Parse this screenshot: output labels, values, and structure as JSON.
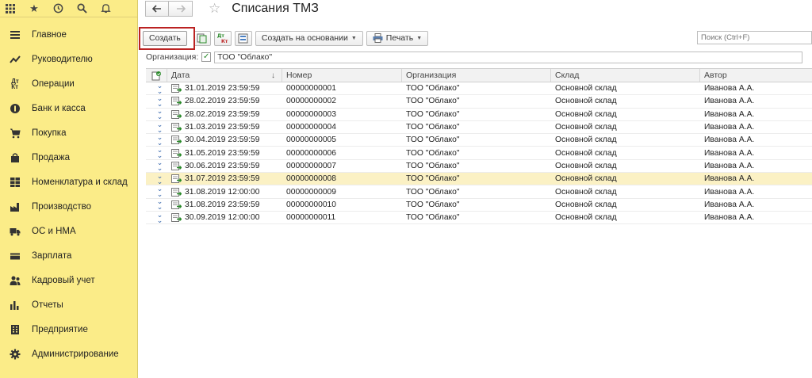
{
  "page": {
    "title": "Списания ТМЗ"
  },
  "sidebar": {
    "top_icons": [
      "apps-grid-icon",
      "star-icon",
      "history-icon",
      "search-icon",
      "bell-icon"
    ],
    "items": [
      {
        "label": "Главное",
        "icon": "menu-icon"
      },
      {
        "label": "Руководителю",
        "icon": "trend-icon"
      },
      {
        "label": "Операции",
        "icon": "dt-kt-icon"
      },
      {
        "label": "Банк и касса",
        "icon": "coin-icon"
      },
      {
        "label": "Покупка",
        "icon": "cart-icon"
      },
      {
        "label": "Продажа",
        "icon": "bag-icon"
      },
      {
        "label": "Номенклатура и склад",
        "icon": "grid-icon"
      },
      {
        "label": "Производство",
        "icon": "factory-icon"
      },
      {
        "label": "ОС и НМА",
        "icon": "truck-icon"
      },
      {
        "label": "Зарплата",
        "icon": "wallet-icon"
      },
      {
        "label": "Кадровый учет",
        "icon": "people-icon"
      },
      {
        "label": "Отчеты",
        "icon": "bar-chart-icon"
      },
      {
        "label": "Предприятие",
        "icon": "building-icon"
      },
      {
        "label": "Администрирование",
        "icon": "gear-icon"
      }
    ]
  },
  "toolbar": {
    "create_label": "Создать",
    "create_based_label": "Создать на основании",
    "print_label": "Печать",
    "search_placeholder": "Поиск (Ctrl+F)"
  },
  "filter": {
    "label": "Организация:",
    "value": "ТОО \"Облако\""
  },
  "table": {
    "columns": [
      "Дата",
      "Номер",
      "Организация",
      "Склад",
      "Автор"
    ],
    "rows": [
      {
        "date": "31.01.2019 23:59:59",
        "number": "00000000001",
        "org": "ТОО \"Облако\"",
        "warehouse": "Основной склад",
        "author": "Иванова А.А."
      },
      {
        "date": "28.02.2019 23:59:59",
        "number": "00000000002",
        "org": "ТОО \"Облако\"",
        "warehouse": "Основной склад",
        "author": "Иванова А.А."
      },
      {
        "date": "28.02.2019 23:59:59",
        "number": "00000000003",
        "org": "ТОО \"Облако\"",
        "warehouse": "Основной склад",
        "author": "Иванова А.А."
      },
      {
        "date": "31.03.2019 23:59:59",
        "number": "00000000004",
        "org": "ТОО \"Облако\"",
        "warehouse": "Основной склад",
        "author": "Иванова А.А."
      },
      {
        "date": "30.04.2019 23:59:59",
        "number": "00000000005",
        "org": "ТОО \"Облако\"",
        "warehouse": "Основной склад",
        "author": "Иванова А.А."
      },
      {
        "date": "31.05.2019 23:59:59",
        "number": "00000000006",
        "org": "ТОО \"Облако\"",
        "warehouse": "Основной склад",
        "author": "Иванова А.А."
      },
      {
        "date": "30.06.2019 23:59:59",
        "number": "00000000007",
        "org": "ТОО \"Облако\"",
        "warehouse": "Основной склад",
        "author": "Иванова А.А."
      },
      {
        "date": "31.07.2019 23:59:59",
        "number": "00000000008",
        "org": "ТОО \"Облако\"",
        "warehouse": "Основной склад",
        "author": "Иванова А.А.",
        "selected": true
      },
      {
        "date": "31.08.2019 12:00:00",
        "number": "00000000009",
        "org": "ТОО \"Облако\"",
        "warehouse": "Основной склад",
        "author": "Иванова А.А."
      },
      {
        "date": "31.08.2019 23:59:59",
        "number": "00000000010",
        "org": "ТОО \"Облако\"",
        "warehouse": "Основной склад",
        "author": "Иванова А.А."
      },
      {
        "date": "30.09.2019 12:00:00",
        "number": "00000000011",
        "org": "ТОО \"Облако\"",
        "warehouse": "Основной склад",
        "author": "Иванова А.А."
      }
    ]
  },
  "colors": {
    "sidebar_bg": "#fbec88",
    "selected_row": "#fbf1c4",
    "highlight_border": "#b22222",
    "doc_icon": "#2a8a2a"
  }
}
